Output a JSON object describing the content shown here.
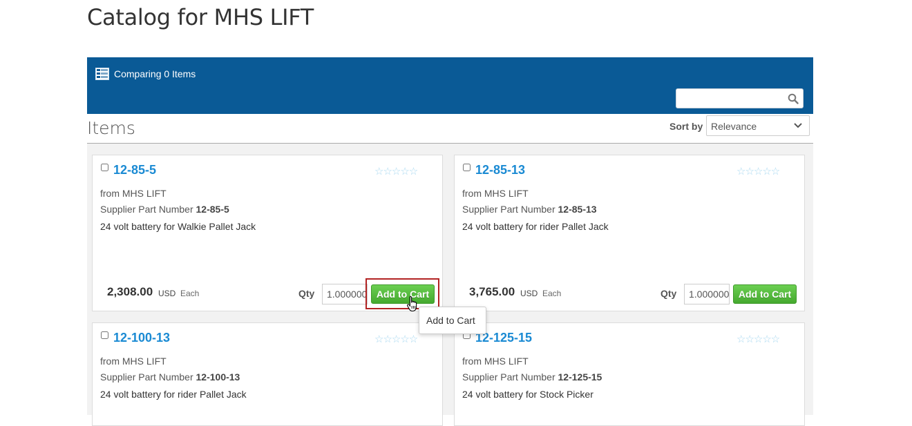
{
  "page": {
    "title": "Catalog for MHS LIFT"
  },
  "compare": {
    "label": "Comparing 0 Items",
    "icon": "compare-grid-icon"
  },
  "search": {
    "value": "",
    "placeholder": "",
    "icon": "search-icon"
  },
  "items_section": {
    "heading": "Items",
    "sort_label": "Sort by",
    "sort_value": "Relevance"
  },
  "products": [
    {
      "name": "12-85-5",
      "from": "from MHS LIFT",
      "spn_label": "Supplier Part Number",
      "spn": "12-85-5",
      "description": "24 volt battery for Walkie Pallet Jack",
      "price": "2,308.00",
      "currency": "USD",
      "unit": "Each",
      "qty_label": "Qty",
      "qty": "1.000000",
      "add_label": "Add to Cart",
      "rating": 0
    },
    {
      "name": "12-85-13",
      "from": "from MHS LIFT",
      "spn_label": "Supplier Part Number",
      "spn": "12-85-13",
      "description": "24 volt battery for rider Pallet Jack",
      "price": "3,765.00",
      "currency": "USD",
      "unit": "Each",
      "qty_label": "Qty",
      "qty": "1.000000",
      "add_label": "Add to Cart",
      "rating": 0
    },
    {
      "name": "12-100-13",
      "from": "from MHS LIFT",
      "spn_label": "Supplier Part Number",
      "spn": "12-100-13",
      "description": "24 volt battery for rider Pallet Jack",
      "rating": 0
    },
    {
      "name": "12-125-15",
      "from": "from MHS LIFT",
      "spn_label": "Supplier Part Number",
      "spn": "12-125-15",
      "description": "24 volt battery for Stock Picker",
      "rating": 0
    }
  ],
  "tooltip": {
    "text": "Add to Cart"
  },
  "colors": {
    "header_bar": "#0a5a96",
    "link": "#1a8ad3",
    "button_green": "#5cbf45",
    "highlight": "#b22222"
  }
}
